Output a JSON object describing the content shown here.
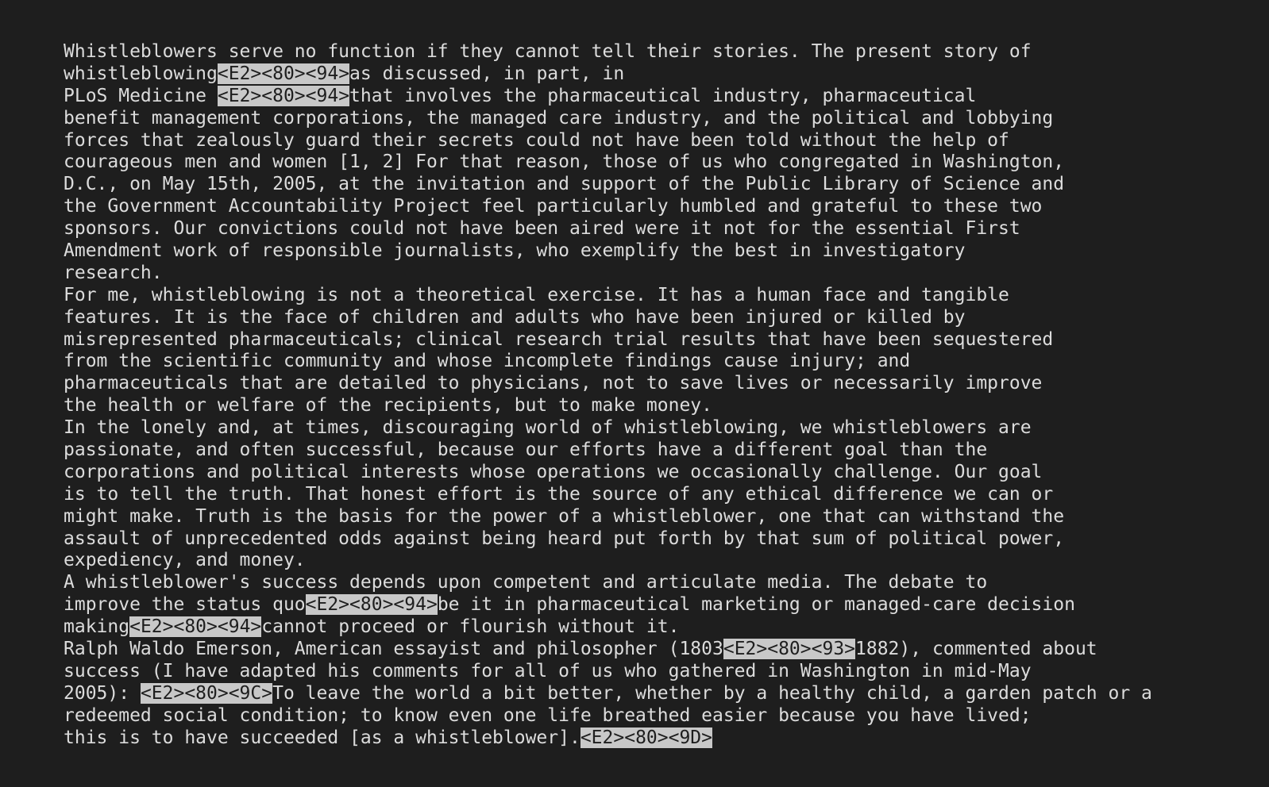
{
  "terminal": {
    "lines": [
      [
        {
          "t": "Whistleblowers serve no function if they cannot tell their stories. The present story of"
        }
      ],
      [
        {
          "t": "whistleblowing"
        },
        {
          "t": "<E2><80><94>",
          "esc": true
        },
        {
          "t": "as discussed, in part, in"
        }
      ],
      [
        {
          "t": "PLoS Medicine "
        },
        {
          "t": "<E2><80><94>",
          "esc": true
        },
        {
          "t": "that involves the pharmaceutical industry, pharmaceutical"
        }
      ],
      [
        {
          "t": "benefit management corporations, the managed care industry, and the political and lobbying"
        }
      ],
      [
        {
          "t": "forces that zealously guard their secrets could not have been told without the help of"
        }
      ],
      [
        {
          "t": "courageous men and women [1, 2] For that reason, those of us who congregated in Washington,"
        }
      ],
      [
        {
          "t": "D.C., on May 15th, 2005, at the invitation and support of the Public Library of Science and"
        }
      ],
      [
        {
          "t": "the Government Accountability Project feel particularly humbled and grateful to these two"
        }
      ],
      [
        {
          "t": "sponsors. Our convictions could not have been aired were it not for the essential First"
        }
      ],
      [
        {
          "t": "Amendment work of responsible journalists, who exemplify the best in investigatory"
        }
      ],
      [
        {
          "t": "research."
        }
      ],
      [
        {
          "t": "For me, whistleblowing is not a theoretical exercise. It has a human face and tangible"
        }
      ],
      [
        {
          "t": "features. It is the face of children and adults who have been injured or killed by"
        }
      ],
      [
        {
          "t": "misrepresented pharmaceuticals; clinical research trial results that have been sequestered"
        }
      ],
      [
        {
          "t": "from the scientific community and whose incomplete findings cause injury; and"
        }
      ],
      [
        {
          "t": "pharmaceuticals that are detailed to physicians, not to save lives or necessarily improve"
        }
      ],
      [
        {
          "t": "the health or welfare of the recipients, but to make money."
        }
      ],
      [
        {
          "t": "In the lonely and, at times, discouraging world of whistleblowing, we whistleblowers are"
        }
      ],
      [
        {
          "t": "passionate, and often successful, because our efforts have a different goal than the"
        }
      ],
      [
        {
          "t": "corporations and political interests whose operations we occasionally challenge. Our goal"
        }
      ],
      [
        {
          "t": "is to tell the truth. That honest effort is the source of any ethical difference we can or"
        }
      ],
      [
        {
          "t": "might make. Truth is the basis for the power of a whistleblower, one that can withstand the"
        }
      ],
      [
        {
          "t": "assault of unprecedented odds against being heard put forth by that sum of political power,"
        }
      ],
      [
        {
          "t": "expediency, and money."
        }
      ],
      [
        {
          "t": "A whistleblower's success depends upon competent and articulate media. The debate to"
        }
      ],
      [
        {
          "t": "improve the status quo"
        },
        {
          "t": "<E2><80><94>",
          "esc": true
        },
        {
          "t": "be it in pharmaceutical marketing or managed-care decision"
        }
      ],
      [
        {
          "t": "making"
        },
        {
          "t": "<E2><80><94>",
          "esc": true
        },
        {
          "t": "cannot proceed or flourish without it."
        }
      ],
      [
        {
          "t": "Ralph Waldo Emerson, American essayist and philosopher (1803"
        },
        {
          "t": "<E2><80><93>",
          "esc": true
        },
        {
          "t": "1882), commented about"
        }
      ],
      [
        {
          "t": "success (I have adapted his comments for all of us who gathered in Washington in mid-May"
        }
      ],
      [
        {
          "t": "2005): "
        },
        {
          "t": "<E2><80><9C>",
          "esc": true
        },
        {
          "t": "To leave the world a bit better, whether by a healthy child, a garden patch or a"
        }
      ],
      [
        {
          "t": "redeemed social condition; to know even one life breathed easier because you have lived;"
        }
      ],
      [
        {
          "t": "this is to have succeeded [as a whistleblower]."
        },
        {
          "t": "<E2><80><9D>",
          "esc": true
        }
      ]
    ]
  }
}
